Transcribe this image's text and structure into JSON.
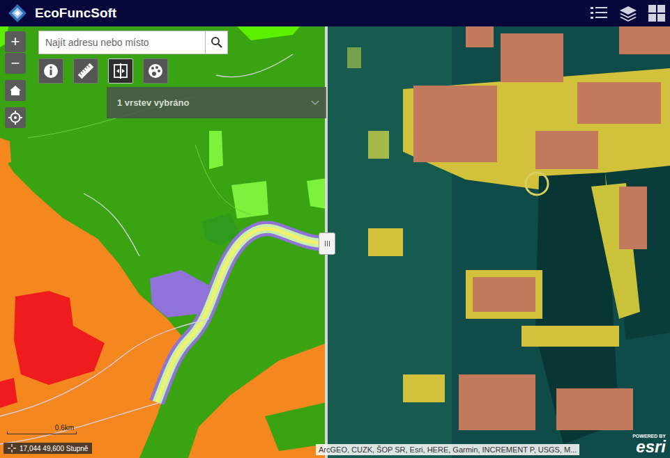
{
  "header": {
    "title": "EcoFuncSoft"
  },
  "zoom": [
    {
      "label": "+"
    },
    {
      "label": "−"
    }
  ],
  "search": {
    "placeholder": "Najít adresu nebo místo"
  },
  "tools": [
    {
      "kind": "info",
      "selected": false
    },
    {
      "kind": "measure",
      "selected": false
    },
    {
      "kind": "swipe",
      "selected": true
    },
    {
      "kind": "layers",
      "selected": false
    }
  ],
  "layer_select": {
    "label": "1 vrstev vybráno"
  },
  "scale": "0.6km",
  "coordinates": "17,044 49,600 Stupně",
  "attribution": "ArcGEO, CUZK, ŠOP SR, Esri, HERE, Garmin, INCREMENT P, USGS, M...",
  "powered_by": {
    "small": "POWERED BY",
    "brand": "esri"
  }
}
